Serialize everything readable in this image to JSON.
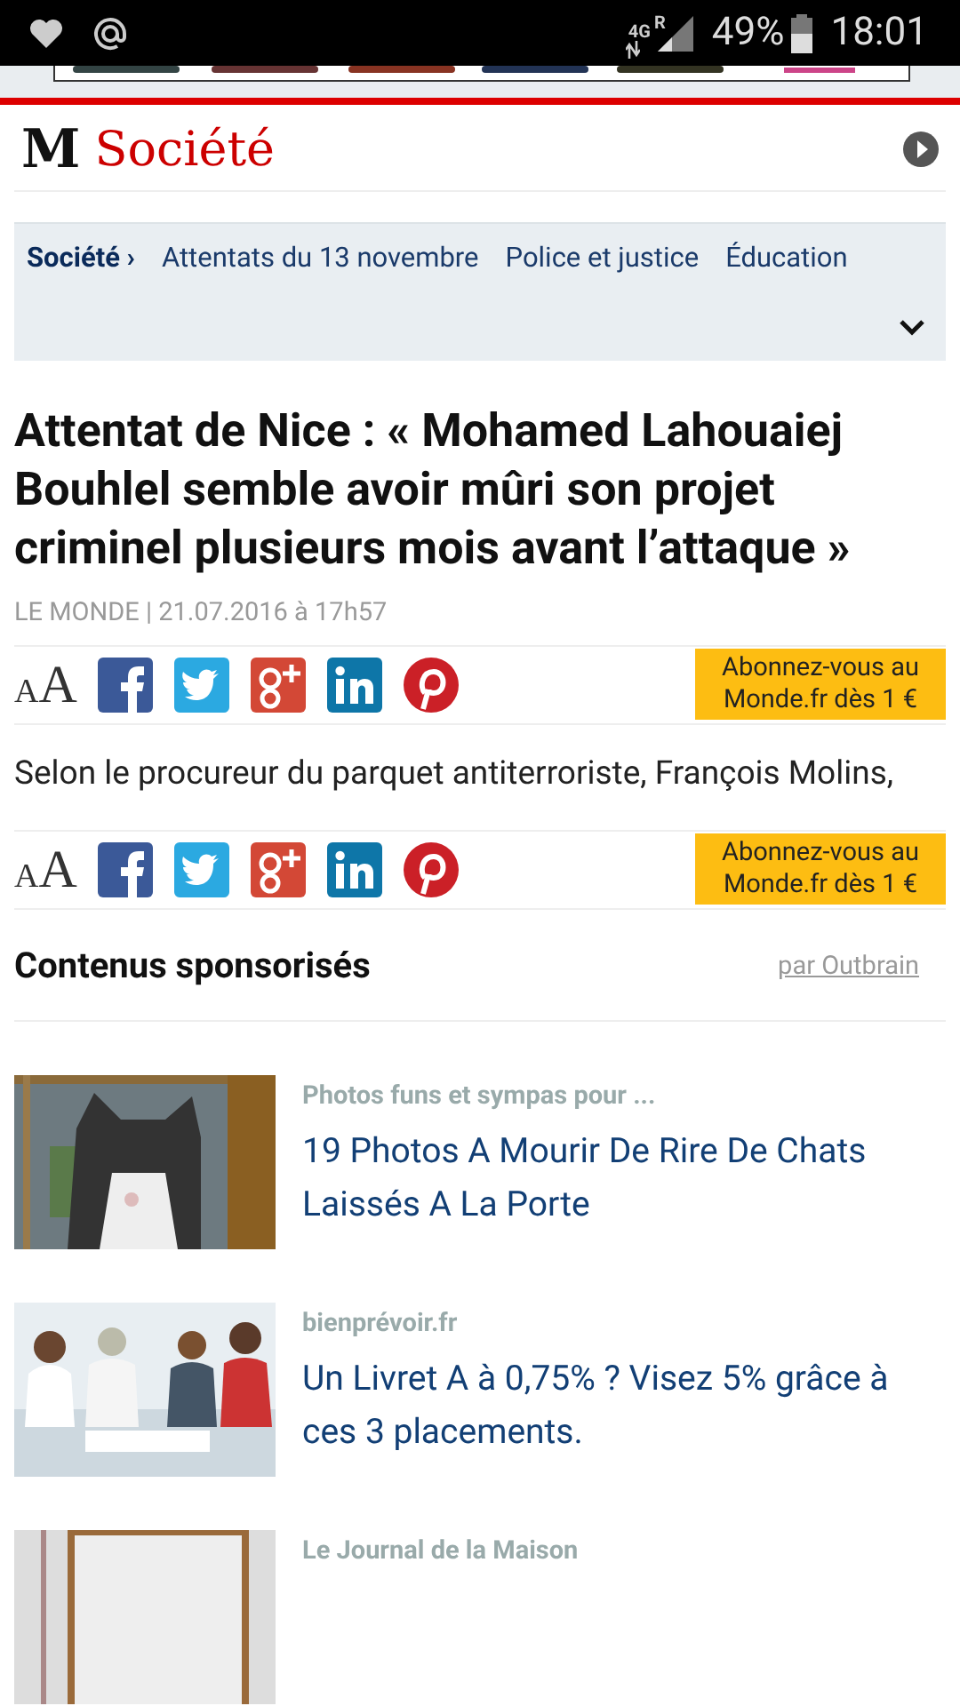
{
  "status_bar": {
    "network": "4G",
    "roaming": "R",
    "battery": "49%",
    "time": "18:01"
  },
  "section": {
    "logo": "M",
    "title": "Société"
  },
  "nav": [
    {
      "label": "Société ›",
      "selected": true
    },
    {
      "label": "Attentats du 13 novembre",
      "selected": false
    },
    {
      "label": "Police et justice",
      "selected": false
    },
    {
      "label": "Éducation",
      "selected": false
    }
  ],
  "article": {
    "headline": "Attentat de Nice : « Mohamed Lahouaiej Bouhlel semble avoir mûri son projet criminel plusieurs mois avant l’attaque »",
    "byline": "LE MONDE | 21.07.2016 à 17h57",
    "body": "Selon le procureur du parquet antiterroriste, François Molins,"
  },
  "share_bars": [
    {
      "font_small": "A",
      "font_large": "A",
      "subscribe": "Abonnez-vous au Monde.fr dès 1 €"
    },
    {
      "font_small": "A",
      "font_large": "A",
      "subscribe": "Abonnez-vous au Monde.fr dès 1 €"
    }
  ],
  "sponsored": {
    "title": "Contenus sponsorisés",
    "by": "par Outbrain",
    "items": [
      {
        "source": "Photos funs et sympas pour ...",
        "headline": "19 Photos A Mourir De Rire De Chats Laissés A La Porte"
      },
      {
        "source": "bienprévoir.fr",
        "headline": "Un Livret A à 0,75% ? Visez 5% grâce à ces 3 placements."
      },
      {
        "source": "Le Journal de la Maison"
      }
    ]
  }
}
